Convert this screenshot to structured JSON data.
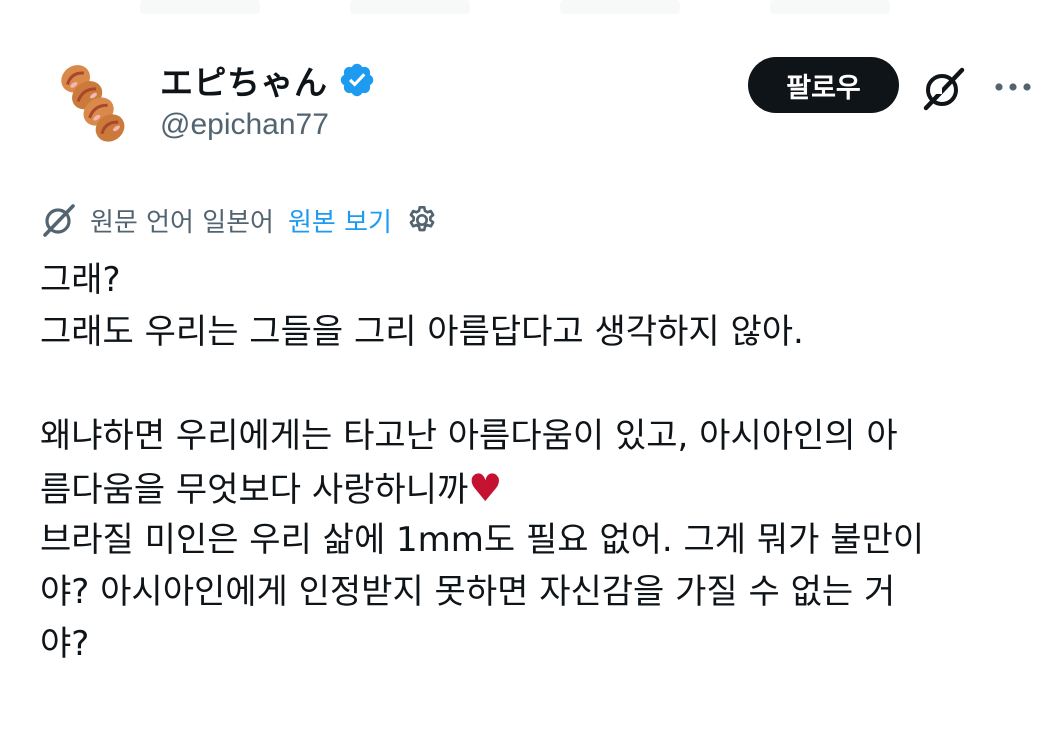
{
  "header": {
    "display_name": "エピちゃん",
    "handle": "@epichan77",
    "verified_icon": "verified-badge-icon",
    "follow_label": "팔로우",
    "grok_icon": "grok-icon",
    "more_icon": "more-dots-icon"
  },
  "translation": {
    "note": "원문 언어 일본어",
    "show_original_label": "원본 보기",
    "settings_icon": "gear-icon"
  },
  "tweet": {
    "line1": "그래?",
    "line2": "그래도 우리는 그들을 그리 아름답다고 생각하지 않아.",
    "line3": "왜냐하면 우리에게는 타고난 아름다움이 있고, 아시아인의 아",
    "line4": "름다움을 무엇보다 사랑하니까",
    "heart": "♥",
    "line5": "브라질 미인은 우리 삶에 1mm도 필요 없어. 그게 뭐가 불만이",
    "line6": "야? 아시아인에게 인정받지 못하면 자신감을 가질 수 없는 거",
    "line7": "야?"
  },
  "colors": {
    "accent": "#1d9bf0",
    "text": "#0f1419",
    "muted": "#536471",
    "heart": "#c41230"
  }
}
